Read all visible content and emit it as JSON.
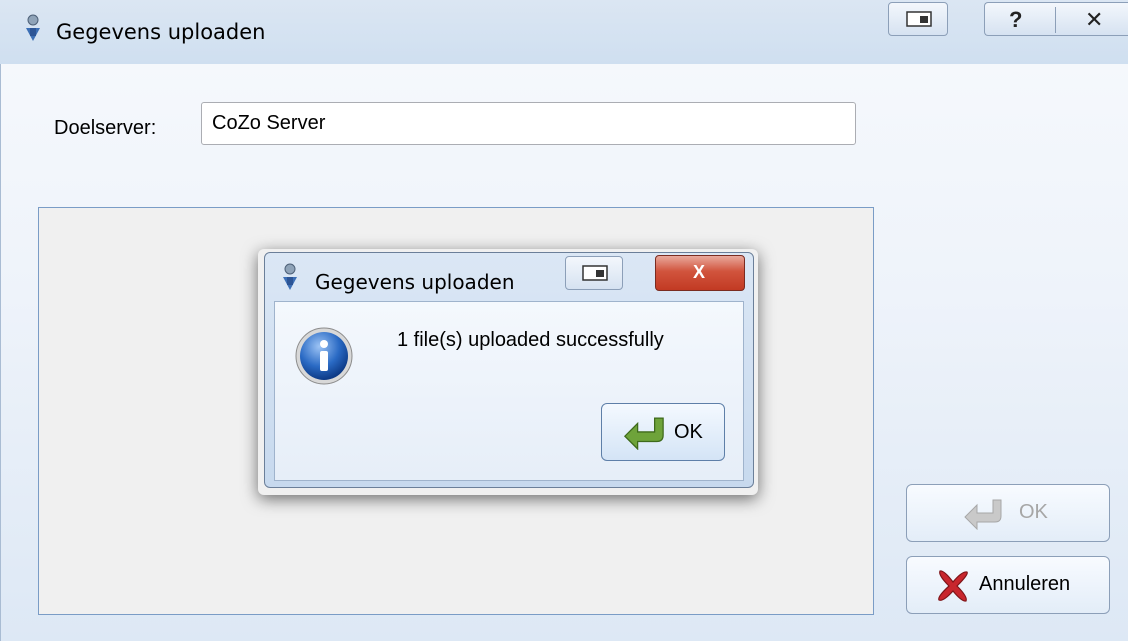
{
  "main_window": {
    "title": "Gegevens uploaden",
    "buttons": {
      "help_glyph": "?",
      "close_glyph": "✕"
    }
  },
  "form": {
    "server_label": "Doelserver:",
    "server_value": "CoZo Server"
  },
  "side_buttons": {
    "ok_label": "OK",
    "cancel_label": "Annuleren"
  },
  "dialog": {
    "title": "Gegevens uploaden",
    "message": "1 file(s) uploaded successfully",
    "ok_label": "OK",
    "close_glyph": "X"
  },
  "icons": {
    "app": "app-person-icon",
    "info": "info-icon",
    "ok_arrow": "green-return-arrow-icon",
    "cancel": "red-x-icon"
  },
  "colors": {
    "titlebar": "#dbe6f3",
    "close_red": "#c23a23",
    "info_blue": "#1f5fb0",
    "ok_green": "#5a8f2e"
  }
}
